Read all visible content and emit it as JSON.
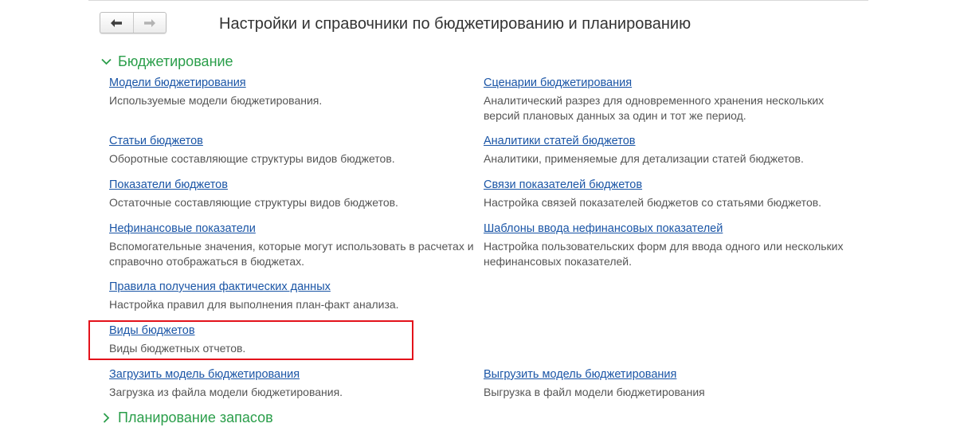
{
  "window": {
    "title": "Настройки и справочники по бюджетированию и планированию"
  },
  "nav": {
    "back_icon": "arrow-left-icon",
    "forward_icon": "arrow-right-icon"
  },
  "groups": [
    {
      "label": "Бюджетирование",
      "expanded": true,
      "icon": "chevron-down-icon"
    },
    {
      "label": "Планирование запасов",
      "expanded": false,
      "icon": "chevron-right-icon"
    }
  ],
  "items": [
    {
      "link": "Модели бюджетирования",
      "desc": "Используемые модели бюджетирования."
    },
    {
      "link": "Сценарии бюджетирования",
      "desc": "Аналитический разрез для одновременного хранения нескольких версий плановых данных за один и тот же период."
    },
    {
      "link": "Статьи бюджетов",
      "desc": "Оборотные составляющие структуры видов бюджетов."
    },
    {
      "link": "Аналитики статей бюджетов",
      "desc": "Аналитики, применяемые для детализации статей бюджетов."
    },
    {
      "link": "Показатели бюджетов",
      "desc": "Остаточные составляющие структуры видов бюджетов."
    },
    {
      "link": "Связи показателей бюджетов",
      "desc": "Настройка связей показателей бюджетов со статьями бюджетов."
    },
    {
      "link": "Нефинансовые показатели",
      "desc": "Вспомогательные значения, которые могут использовать в расчетах и справочно отображаться в бюджетах."
    },
    {
      "link": "Шаблоны ввода нефинансовых показателей",
      "desc": "Настройка пользовательских форм для ввода одного или нескольких нефинансовых показателей."
    },
    {
      "link": "Правила получения фактических данных",
      "desc": "Настройка правил для выполнения план-факт анализа."
    },
    {
      "link": "Виды бюджетов",
      "desc": "Виды бюджетных отчетов."
    },
    {
      "link": "Загрузить модель бюджетирования",
      "desc": "Загрузка из файла модели бюджетирования."
    },
    {
      "link": "Выгрузить модель бюджетирования",
      "desc": "Выгрузка в файл модели бюджетирования"
    }
  ],
  "colors": {
    "group_header": "#2a9e4a",
    "link": "#1a55a6",
    "description": "#555555",
    "highlight_border": "#e3121b"
  }
}
